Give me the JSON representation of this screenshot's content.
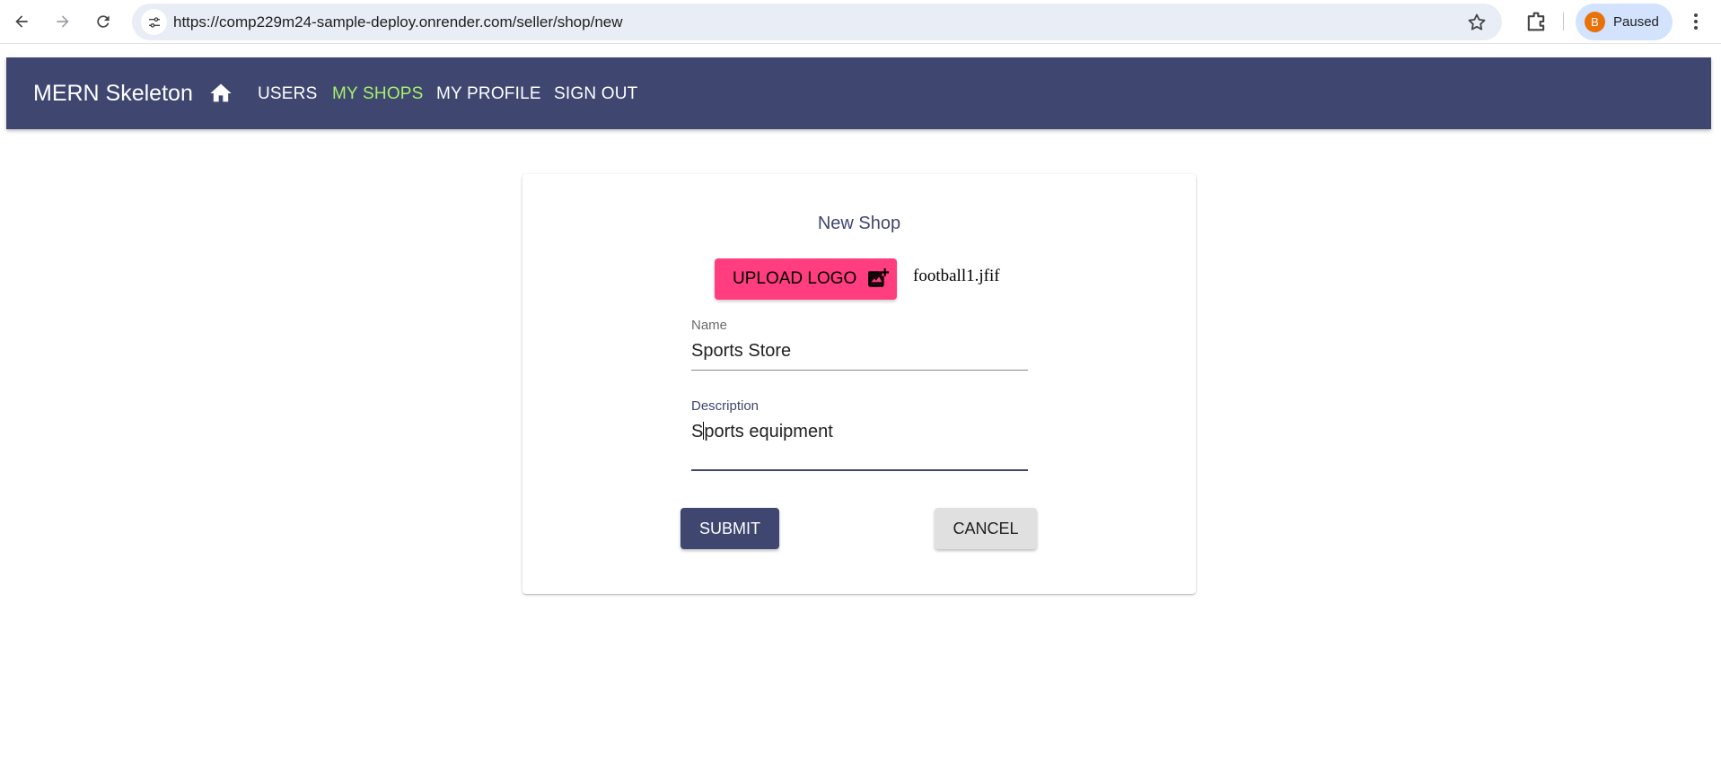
{
  "browser": {
    "url": "https://comp229m24-sample-deploy.onrender.com/seller/shop/new",
    "profile_initial": "B",
    "profile_status": "Paused"
  },
  "appbar": {
    "brand": "MERN Skeleton",
    "links": [
      "USERS",
      "MY SHOPS",
      "MY PROFILE",
      "SIGN OUT"
    ],
    "active_link": "MY SHOPS",
    "active_color": "#a7f06c",
    "bar_color": "#3f4771"
  },
  "form": {
    "title": "New Shop",
    "upload_label": "UPLOAD LOGO",
    "upload_color": "#ff3d7f",
    "filename": "football1.jfif",
    "name": {
      "label": "Name",
      "value": "Sports Store"
    },
    "description": {
      "label": "Description",
      "value_before_caret": "S",
      "value_after_caret": "ports equipment"
    },
    "submit_label": "SUBMIT",
    "cancel_label": "CANCEL"
  }
}
